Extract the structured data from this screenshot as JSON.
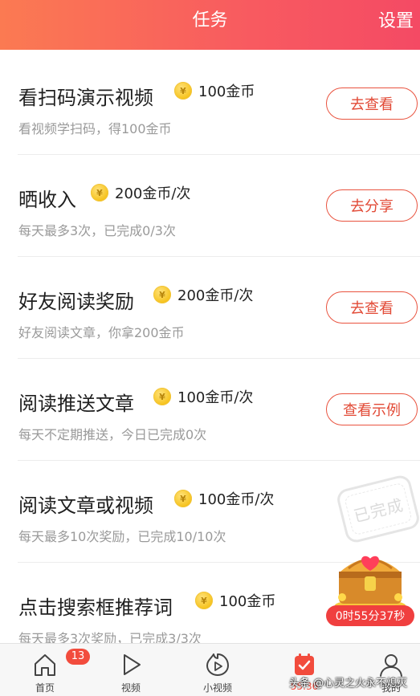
{
  "header": {
    "title": "任务",
    "settings_label": "设置"
  },
  "tasks": [
    {
      "name": "看扫码演示视频",
      "reward": "100金币",
      "desc": "看视频学扫码，得100金币",
      "button": "去查看"
    },
    {
      "name": "晒收入",
      "reward": "200金币/次",
      "desc": "每天最多3次，已完成0/3次",
      "button": "去分享"
    },
    {
      "name": "好友阅读奖励",
      "reward": "200金币/次",
      "desc": "好友阅读文章，你拿200金币",
      "button": "去查看"
    },
    {
      "name": "阅读推送文章",
      "reward": "100金币/次",
      "desc": "每天不定期推送，今日已完成0次",
      "button": "查看示例"
    },
    {
      "name": "阅读文章或视频",
      "reward": "100金币/次",
      "desc": "每天最多10次奖励，已完成10/10次",
      "status": "已完成"
    },
    {
      "name": "点击搜索框推荐词",
      "reward": "100金币",
      "desc": "每天最多3次奖励，已完成3/3次"
    }
  ],
  "chest": {
    "timer": "0时55分37秒"
  },
  "tabbar": {
    "items": [
      {
        "label": "首页",
        "icon": "home-icon",
        "badge": "13"
      },
      {
        "label": "视频",
        "icon": "play-icon"
      },
      {
        "label": "小视频",
        "icon": "small-video-icon"
      },
      {
        "label": "55:36",
        "icon": "task-check-icon",
        "active": true
      },
      {
        "label": "我的",
        "icon": "profile-icon"
      }
    ]
  },
  "watermark": "头条 @心灵之火永不熄灭",
  "colors": {
    "accent": "#f85a60",
    "button_border": "#e9533f",
    "active_tab": "#f24c3d"
  }
}
